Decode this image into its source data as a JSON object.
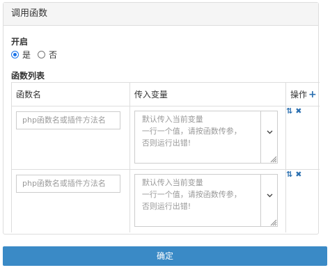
{
  "panel": {
    "title": "调用函数"
  },
  "enable": {
    "label": "开启",
    "options": [
      {
        "label": "是",
        "checked": true
      },
      {
        "label": "否",
        "checked": false
      }
    ]
  },
  "function_list": {
    "label": "函数列表",
    "headers": {
      "name": "函数名",
      "vars": "传入变量",
      "ops": "操作"
    },
    "rows": [
      {
        "name_placeholder": "php函数名或插件方法名",
        "vars_placeholder": "默认传入当前变量\n一行一个值，请按函数传参，\n否则运行出错!"
      },
      {
        "name_placeholder": "php函数名或插件方法名",
        "vars_placeholder": "默认传入当前变量\n一行一个值，请按函数传参，\n否则运行出错!"
      }
    ]
  },
  "icons": {
    "sort": "sort-icon",
    "remove": "remove-icon",
    "add": "plus-icon",
    "chevron": "chevron-down-icon"
  },
  "confirm_button": {
    "label": "确定"
  },
  "colors": {
    "primary": "#3a8ac6",
    "accent": "#2a6fb0"
  }
}
